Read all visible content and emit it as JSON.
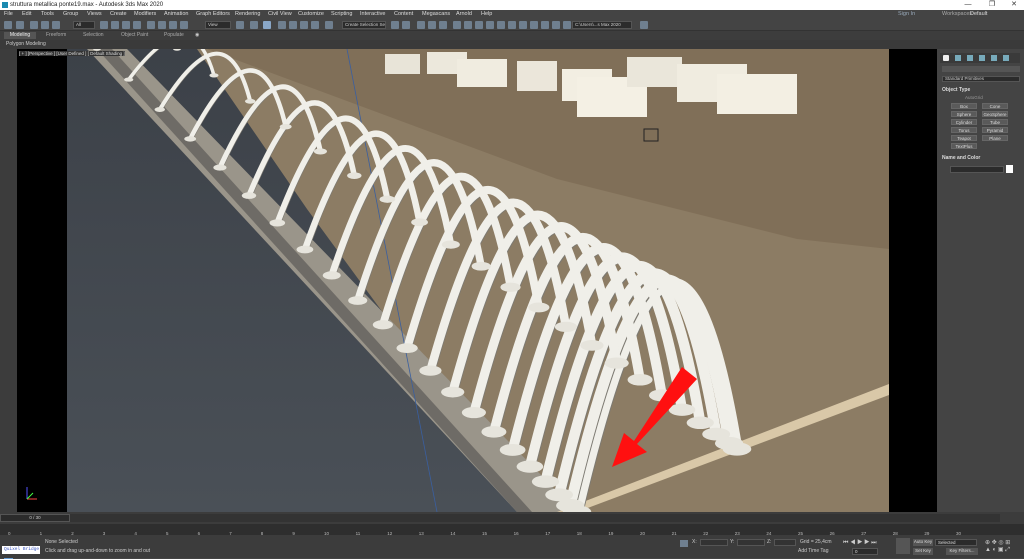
{
  "window": {
    "title": "struttura metallica ponte19.max - Autodesk 3ds Max 2020",
    "controls": [
      "—",
      "❐",
      "✕"
    ]
  },
  "menu": [
    "File",
    "Edit",
    "Tools",
    "Group",
    "Views",
    "Create",
    "Modifiers",
    "Animation",
    "Graph Editors",
    "Rendering",
    "Civil View",
    "Customize",
    "Scripting",
    "Interactive",
    "Content",
    "Megascans",
    "Arnold",
    "Help"
  ],
  "account": {
    "sign_in": "Sign In",
    "workspaces_label": "Workspaces:",
    "workspace": "Default"
  },
  "toolbar": {
    "filter_dropdown": "All",
    "view_dropdown": "View",
    "selection_set": "Create Selection Se",
    "path": "C:\\Users\\...s Max 2020"
  },
  "ribbon": {
    "tabs": [
      "Modeling",
      "Freeform",
      "Selection",
      "Object Paint",
      "Populate"
    ],
    "sub": "Polygon Modeling"
  },
  "viewport": {
    "label": "[ + ] [Perspective ] [User Defined ] [ Default Shading ]"
  },
  "command_panel": {
    "dropdown": "Standard Primitives",
    "object_type_title": "Object Type",
    "autogrid": "AutoGrid",
    "primitives": [
      "Box",
      "Cone",
      "Sphere",
      "GeoSphere",
      "Cylinder",
      "Tube",
      "Torus",
      "Pyramid",
      "Teapot",
      "Plane",
      "TextPlus"
    ],
    "name_color_title": "Name and Color"
  },
  "timeline": {
    "frame_counter": "0 / 30",
    "ticks": [
      "0",
      "1",
      "2",
      "3",
      "4",
      "5",
      "6",
      "7",
      "8",
      "9",
      "10",
      "11",
      "12",
      "13",
      "14",
      "15",
      "16",
      "17",
      "18",
      "19",
      "20",
      "21",
      "22",
      "23",
      "24",
      "25",
      "26",
      "27",
      "28",
      "29",
      "30"
    ]
  },
  "status": {
    "script_box": "Quixel Bridge",
    "selection": "None Selected",
    "prompt": "Click and drag up-and-down to zoom in and out",
    "x_label": "X:",
    "y_label": "Y:",
    "z_label": "Z:",
    "grid": "Grid = 25,4cm",
    "add_time_tag": "Add Time Tag",
    "auto_key": "Auto Key",
    "set_key": "Set Key",
    "selected": "Selected",
    "key_filters": "Key Filters...",
    "frame": "0"
  },
  "colors": {
    "arrow": "#ff1010",
    "arch": "#f0efe9",
    "ground": "#8a7760"
  }
}
